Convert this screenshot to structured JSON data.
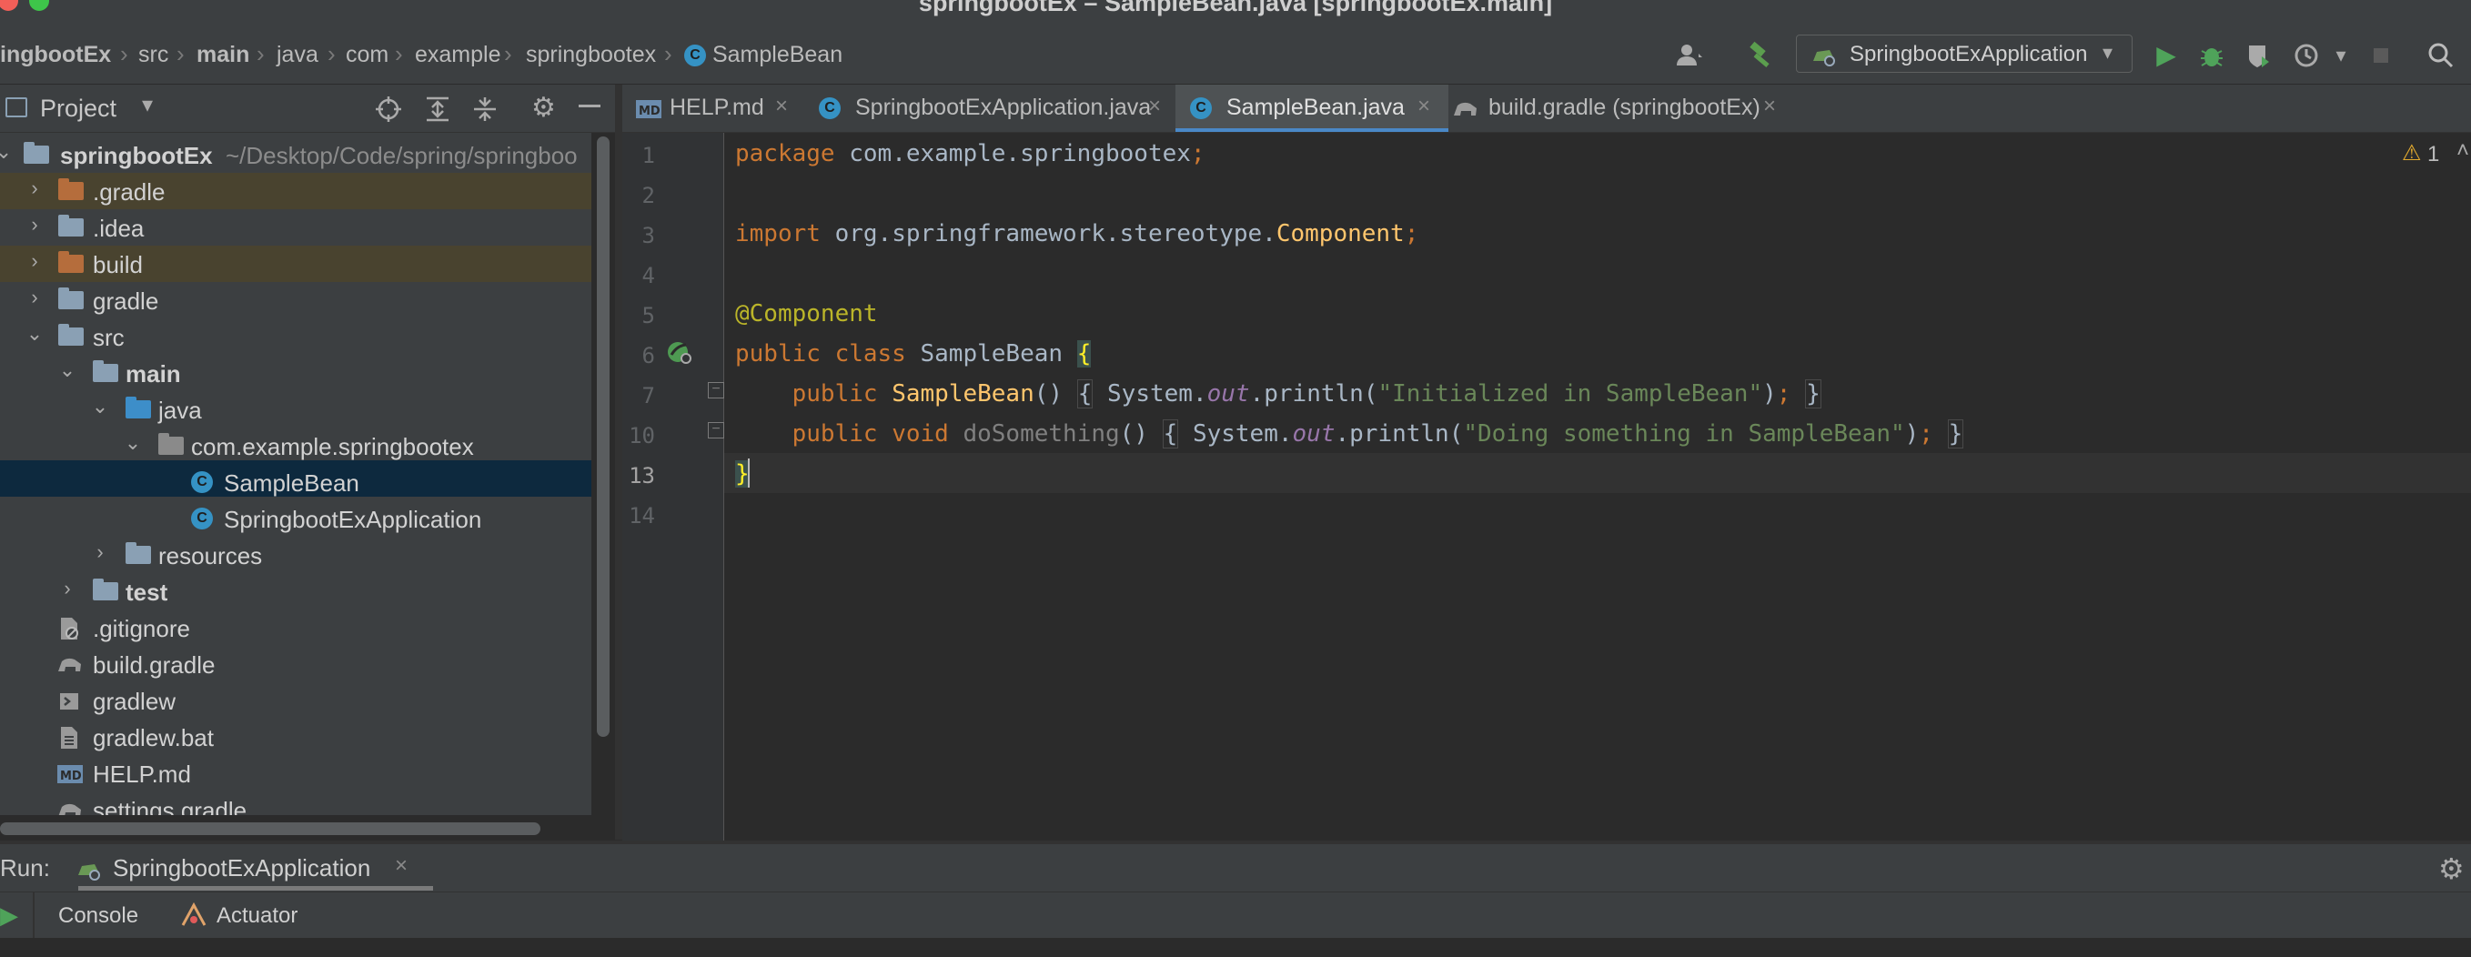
{
  "window": {
    "title": "springbootEx – SampleBean.java [springbootEx.main]"
  },
  "breadcrumbs": [
    "ingbootEx",
    "src",
    "main",
    "java",
    "com",
    "example",
    "springbootex",
    "SampleBean"
  ],
  "toolbar": {
    "run_config": "SpringbootExApplication"
  },
  "project_panel": {
    "title": "Project",
    "tree": [
      {
        "label": "springbootEx",
        "path": "~/Desktop/Code/spring/springboo"
      },
      {
        "label": ".gradle"
      },
      {
        "label": ".idea"
      },
      {
        "label": "build"
      },
      {
        "label": "gradle"
      },
      {
        "label": "src"
      },
      {
        "label": "main"
      },
      {
        "label": "java"
      },
      {
        "label": "com.example.springbootex"
      },
      {
        "label": "SampleBean"
      },
      {
        "label": "SpringbootExApplication"
      },
      {
        "label": "resources"
      },
      {
        "label": "test"
      },
      {
        "label": ".gitignore"
      },
      {
        "label": "build.gradle"
      },
      {
        "label": "gradlew"
      },
      {
        "label": "gradlew.bat"
      },
      {
        "label": "HELP.md"
      },
      {
        "label": "settings.gradle"
      }
    ]
  },
  "editor": {
    "tabs": [
      {
        "label": "HELP.md",
        "active": false
      },
      {
        "label": "SpringbootExApplication.java",
        "active": false
      },
      {
        "label": "SampleBean.java",
        "active": true
      },
      {
        "label": "build.gradle (springbootEx)",
        "active": false
      }
    ],
    "line_numbers": [
      "1",
      "2",
      "3",
      "4",
      "5",
      "6",
      "7",
      "10",
      "13",
      "14"
    ],
    "code": {
      "l1_kw": "package",
      "l1_rest": " com.example.springbootex",
      "semi": ";",
      "l3_kw": "import",
      "l3_rest": " org.springframework.stereotype.",
      "l3_comp": "Component",
      "l5_ann": "@Component",
      "l6_kw": "public class",
      "l6_name": " SampleBean ",
      "brace_open": "{",
      "brace_close": "}",
      "l7_kw": "public",
      "l7_name": "SampleBean",
      "parens": "()",
      "system_out": "System.",
      "out": "out",
      "println": ".println(",
      "l7_str": "\"Initialized in SampleBean\"",
      "close_paren": ")",
      "l10_kw": "public void",
      "l10_name": "doSomething",
      "l10_str": "\"Doing something in SampleBean\""
    },
    "warnings_count": "1"
  },
  "run_panel": {
    "label": "Run:",
    "config_tab": "SpringbootExApplication",
    "tabs": [
      "Console",
      "Actuator"
    ]
  }
}
